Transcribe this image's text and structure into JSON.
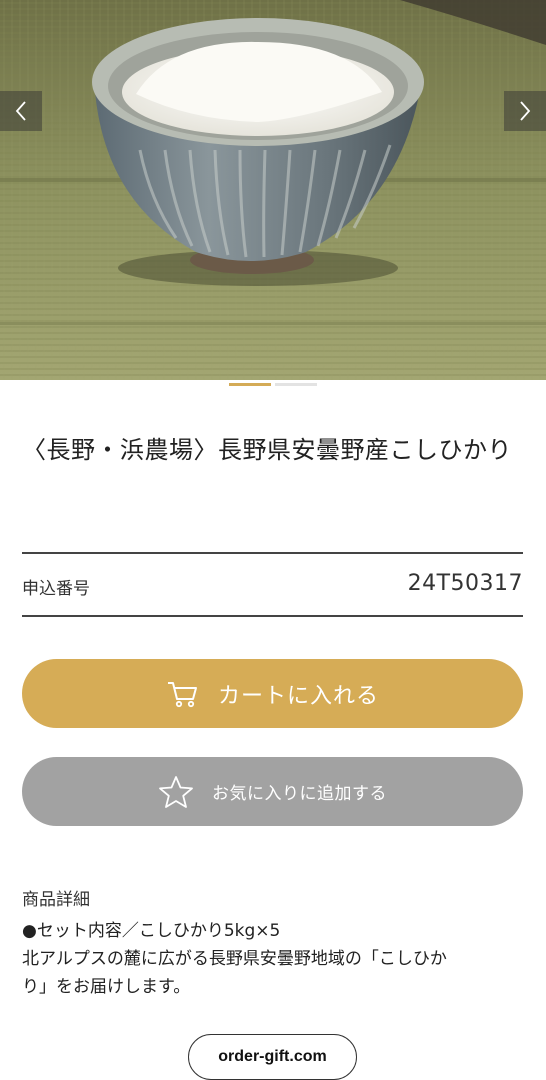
{
  "product": {
    "title": "〈長野・浜農場〉長野県安曇野産こしひかり",
    "order_label": "申込番号",
    "order_number": "24T50317"
  },
  "carousel": {
    "active_index": 0,
    "count": 2
  },
  "buttons": {
    "cart_label": "カートに入れる",
    "favorite_label": "お気に入りに追加する"
  },
  "details": {
    "heading": "商品詳細",
    "lines": [
      "●セット内容／こしひかり5kg×5",
      "北アルプスの麓に広がる長野県安曇野地域の「こしひか",
      "り」をお届けします。"
    ]
  },
  "footer": {
    "domain": "order-gift.com"
  },
  "colors": {
    "accent": "#d6ac56",
    "secondary_button": "#a2a2a2"
  },
  "icons": [
    "chevron-left-icon",
    "chevron-right-icon",
    "cart-icon",
    "star-icon"
  ]
}
